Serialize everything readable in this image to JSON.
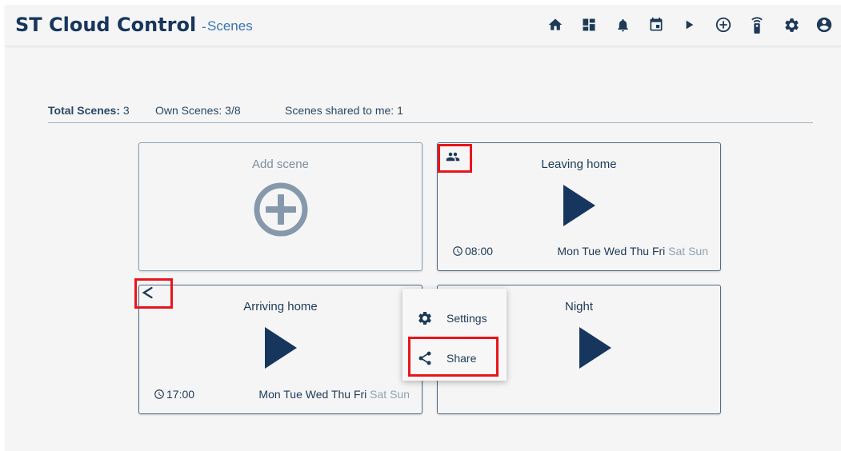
{
  "header": {
    "brand": "ST Cloud Control",
    "separator": "-",
    "subtitle": "Scenes",
    "icons": [
      "home-icon",
      "dashboard-icon",
      "bell-icon",
      "calendar-icon",
      "play-icon",
      "add-circle-icon",
      "remote-icon",
      "gear-icon",
      "account-icon"
    ]
  },
  "stats": {
    "total_label": "Total Scenes:",
    "total_value": "3",
    "own_label": "Own Scenes:",
    "own_value": "3/8",
    "shared_label": "Scenes shared to me:",
    "shared_value": "1"
  },
  "cards": {
    "add": {
      "title": "Add scene",
      "icon": "add-circle-icon"
    },
    "leaving": {
      "title": "Leaving home",
      "time": "08:00",
      "weekdays": "Mon Tue Wed Thu Fri",
      "weekend": "Sat Sun",
      "badge_icon": "people-icon"
    },
    "arriving": {
      "title": "Arriving home",
      "time": "17:00",
      "weekdays": "Mon Tue Wed Thu Fri",
      "weekend": "Sat Sun",
      "badge_icon": "share-icon"
    },
    "night": {
      "title": "Night"
    }
  },
  "menu": {
    "settings_label": "Settings",
    "share_label": "Share"
  },
  "colors": {
    "brand": "#17365d",
    "accent": "#3a74b5",
    "highlight": "#e8151b",
    "muted": "#8fa3b5"
  }
}
